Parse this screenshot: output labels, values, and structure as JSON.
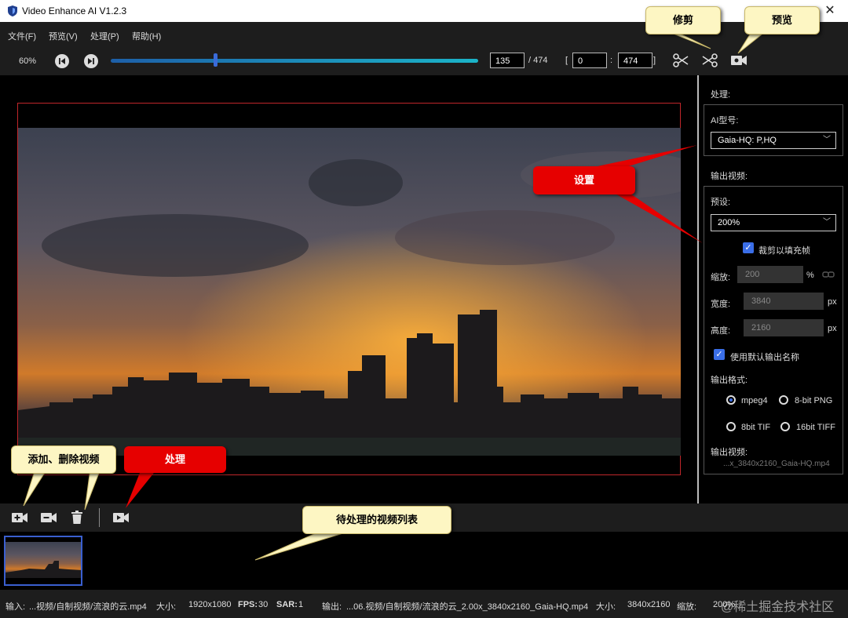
{
  "window": {
    "title": "Video Enhance AI V1.2.3"
  },
  "menu": [
    "文件(F)",
    "预览(V)",
    "处理(P)",
    "帮助(H)"
  ],
  "controls": {
    "zoom": "60%",
    "current_frame": "135",
    "total_frames": "/ 474",
    "range_open": "[",
    "range_start": "0",
    "range_sep": ":",
    "range_end": "474",
    "range_close": "]",
    "slider_position": 0.285
  },
  "callouts": {
    "trim": "修剪",
    "preview": "预览",
    "settings": "设置",
    "add_remove": "添加、删除视频",
    "process": "处理",
    "queue": "待处理的视频列表"
  },
  "panel": {
    "process_title": "处理:",
    "ai_model_label": "AI型号:",
    "ai_model_value": "Gaia-HQ: P,HQ",
    "output_title": "输出视频:",
    "preset_label": "预设:",
    "preset_value": "200%",
    "crop_label": "裁剪以填充帧",
    "scale_label": "缩放:",
    "scale_value": "200",
    "scale_unit": "%",
    "width_label": "宽度:",
    "width_value": "3840",
    "width_unit": "px",
    "height_label": "高度:",
    "height_value": "2160",
    "height_unit": "px",
    "default_name_label": "使用默认输出名称",
    "format_label": "输出格式:",
    "formats": [
      "mpeg4",
      "8-bit PNG",
      "8bit TIF",
      "16bit TIFF"
    ],
    "output_file_label": "输出视频:",
    "output_file_value": "...x_3840x2160_Gaia-HQ.mp4"
  },
  "status": {
    "input_label": "输入:",
    "input_value": "...视频/自制视频/流浪的云.mp4",
    "size_label": "大小:",
    "size_value": "1920x1080",
    "fps_label": "FPS:",
    "fps_value": "30",
    "sar_label": "SAR:",
    "sar_value": "1",
    "output_label": "输出:",
    "output_value": "...06.视频/自制视频/流浪的云_2.00x_3840x2160_Gaia-HQ.mp4",
    "out_size_label": "大小:",
    "out_size_value": "3840x2160",
    "scale_label": "缩放:",
    "scale_value": "200%"
  },
  "watermark": "@稀土掘金技术社区",
  "colors": {
    "accent": "#3a6ee8",
    "frame_border": "#c0262a",
    "callout_yellow": "#fdf6c3",
    "callout_red": "#e60000"
  }
}
